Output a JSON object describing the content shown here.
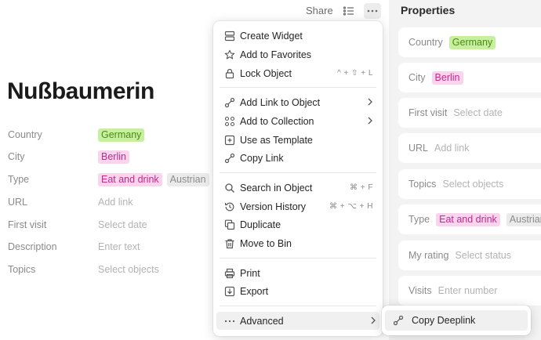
{
  "toolbar": {
    "share_label": "Share"
  },
  "object": {
    "title": "Nußbaumerin",
    "relations": [
      {
        "label": "Country",
        "tags": [
          {
            "text": "Germany",
            "color": "green"
          }
        ]
      },
      {
        "label": "City",
        "tags": [
          {
            "text": "Berlin",
            "color": "pink"
          }
        ]
      },
      {
        "label": "Type",
        "tags": [
          {
            "text": "Eat and drink",
            "color": "pink"
          },
          {
            "text": "Austrian",
            "color": "grey"
          }
        ]
      },
      {
        "label": "URL",
        "placeholder": "Add link"
      },
      {
        "label": "First visit",
        "placeholder": "Select date"
      },
      {
        "label": "Description",
        "placeholder": "Enter text"
      },
      {
        "label": "Topics",
        "placeholder": "Select objects"
      }
    ]
  },
  "panel": {
    "title": "Properties",
    "properties": [
      {
        "label": "Country",
        "tags": [
          {
            "text": "Germany",
            "color": "green"
          }
        ]
      },
      {
        "label": "City",
        "tags": [
          {
            "text": "Berlin",
            "color": "pink"
          }
        ]
      },
      {
        "label": "First visit",
        "placeholder": "Select date"
      },
      {
        "label": "URL",
        "placeholder": "Add link"
      },
      {
        "label": "Topics",
        "placeholder": "Select objects"
      },
      {
        "label": "Type",
        "tags": [
          {
            "text": "Eat and drink",
            "color": "pink"
          },
          {
            "text": "Austrian",
            "color": "grey"
          }
        ]
      },
      {
        "label": "My rating",
        "placeholder": "Select status"
      },
      {
        "label": "Visits",
        "placeholder": "Enter number"
      }
    ]
  },
  "menu": {
    "items": {
      "create_widget": "Create Widget",
      "add_to_favorites": "Add to Favorites",
      "lock_object": "Lock Object",
      "lock_object_shortcut": "^ + ⇧ + L",
      "add_link_to_object": "Add Link to Object",
      "add_to_collection": "Add to Collection",
      "use_as_template": "Use as Template",
      "copy_link": "Copy Link",
      "search_in_object": "Search in Object",
      "search_in_object_shortcut": "⌘ + F",
      "version_history": "Version History",
      "version_history_shortcut": "⌘ + ⌥ + H",
      "duplicate": "Duplicate",
      "move_to_bin": "Move to Bin",
      "print": "Print",
      "export": "Export",
      "advanced": "Advanced"
    }
  },
  "submenu": {
    "copy_deeplink": "Copy Deeplink"
  },
  "colors": {
    "tag_green_bg": "#c6efa0",
    "tag_green_text": "#4f8a10",
    "tag_pink_bg": "#fad4ec",
    "tag_pink_text": "#c02a8f",
    "tag_grey_bg": "#ebebeb",
    "tag_grey_text": "#8c8c8c",
    "panel_bg": "#f3f3f3",
    "active_item_bg": "#f0f0f0"
  }
}
